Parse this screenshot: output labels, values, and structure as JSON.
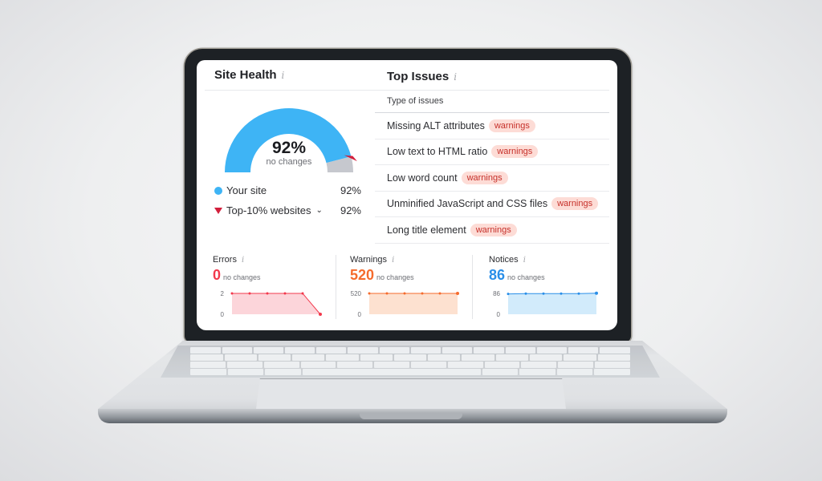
{
  "site_health": {
    "title": "Site Health",
    "info_icon": "i",
    "score_label": "92%",
    "score_value": 92,
    "change_text": "no changes",
    "top10_marker_value": 92,
    "legend": [
      {
        "label": "Your site",
        "value": "92%",
        "marker": "dot",
        "color": "#3eb4f5"
      },
      {
        "label": "Top-10% websites",
        "value": "92%",
        "marker": "triangle-down",
        "color": "#d21f3c",
        "has_dropdown": true
      }
    ],
    "colors": {
      "fill": "#3eb4f5",
      "remainder": "#c6c8ce",
      "marker": "#d21f3c"
    }
  },
  "top_issues": {
    "title": "Top Issues",
    "info_icon": "i",
    "column_header": "Type of issues",
    "items": [
      {
        "label": "Missing ALT attributes",
        "badge": "warnings"
      },
      {
        "label": "Low text to HTML ratio",
        "badge": "warnings"
      },
      {
        "label": "Low word count",
        "badge": "warnings"
      },
      {
        "label": "Unminified JavaScript and CSS files",
        "badge": "warnings"
      },
      {
        "label": "Long title element",
        "badge": "warnings"
      }
    ]
  },
  "stats": [
    {
      "title": "Errors",
      "value": "0",
      "change": "no changes",
      "color": "#f2394c",
      "fill": "#fcd5da",
      "y_ticks": [
        "2",
        "0"
      ],
      "y_max": 2,
      "series": [
        2,
        2,
        2,
        2,
        2,
        0
      ]
    },
    {
      "title": "Warnings",
      "value": "520",
      "change": "no changes",
      "color": "#f56b2d",
      "fill": "#fde1d0",
      "y_ticks": [
        "520",
        "0"
      ],
      "y_max": 520,
      "series": [
        520,
        520,
        520,
        520,
        520,
        520
      ]
    },
    {
      "title": "Notices",
      "value": "86",
      "change": "no changes",
      "color": "#2b8fe8",
      "fill": "#d2ebfb",
      "y_ticks": [
        "86",
        "0"
      ],
      "y_max": 86,
      "series": [
        84,
        85,
        85,
        85,
        85,
        87
      ]
    }
  ]
}
